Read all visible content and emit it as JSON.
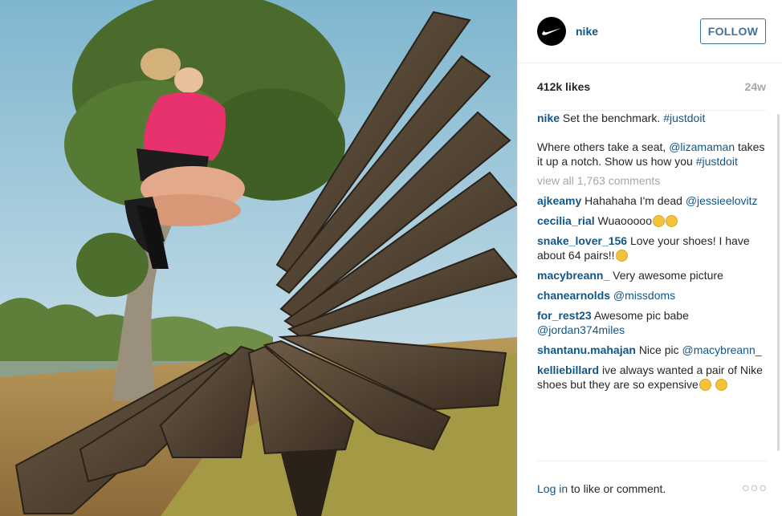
{
  "header": {
    "username": "nike",
    "follow_label": "FOLLOW",
    "avatar_icon": "nike-swoosh-icon"
  },
  "stats": {
    "likes": "412k likes",
    "age": "24w"
  },
  "caption": {
    "username": "nike",
    "text": "Set the benchmark.",
    "hashtag": "#justdoit",
    "p2_a": "Where others take a seat,",
    "p2_mention": "@lizamaman",
    "p2_b": "takes it up a notch. Show us how you",
    "p2_hashtag": "#justdoit"
  },
  "view_all": "view all 1,763 comments",
  "comments": [
    {
      "user": "ajkeamy",
      "text": "Hahahaha I'm dead",
      "mention": "@jessieelovitz"
    },
    {
      "user": "cecilia_rial",
      "text": "Wuaooooo"
    },
    {
      "user": "snake_lover_156",
      "text": "Love your shoes! I have about 64 pairs!!"
    },
    {
      "user": "macybreann_",
      "text": "Very awesome picture"
    },
    {
      "user": "chanearnolds",
      "mention": "@missdoms"
    },
    {
      "user": "for_rest23",
      "text": "Awesome pic babe",
      "mention": "@jordan374miles"
    },
    {
      "user": "shantanu.mahajan",
      "text": "Nice pic",
      "mention": "@macybreann_"
    },
    {
      "user": "kelliebillard",
      "text": "ive always wanted a pair of Nike shoes but they are so expensive"
    }
  ],
  "footer": {
    "login_link": "Log in",
    "login_rest": "to like or comment.",
    "more_icon": "ellipsis-icon"
  },
  "colors": {
    "link": "#125688",
    "follow": "#3f729b",
    "muted": "#a5a7aa",
    "border": "#efefef"
  }
}
